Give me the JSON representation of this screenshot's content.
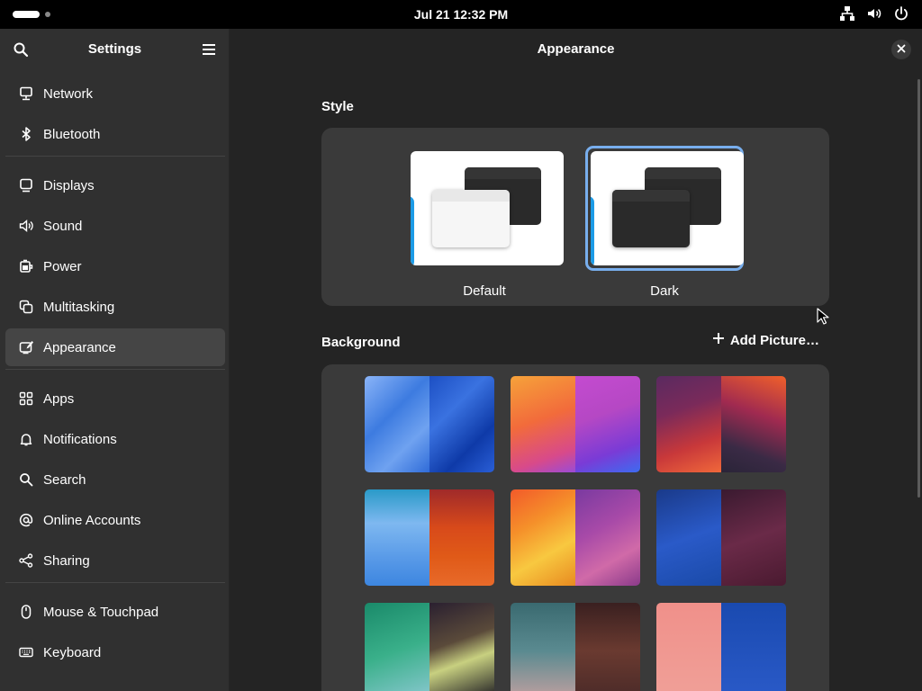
{
  "topbar": {
    "clock": "Jul 21  12:32 PM",
    "tray_icons": [
      "network-wired-icon",
      "volume-icon",
      "power-icon"
    ]
  },
  "sidebar": {
    "title": "Settings",
    "items": [
      {
        "label": "Network",
        "icon": "network-icon"
      },
      {
        "label": "Bluetooth",
        "icon": "bluetooth-icon"
      },
      {
        "label": "Displays",
        "icon": "display-icon"
      },
      {
        "label": "Sound",
        "icon": "speaker-icon"
      },
      {
        "label": "Power",
        "icon": "battery-icon"
      },
      {
        "label": "Multitasking",
        "icon": "multitasking-icon"
      },
      {
        "label": "Appearance",
        "icon": "appearance-icon",
        "active": true
      },
      {
        "label": "Apps",
        "icon": "apps-grid-icon"
      },
      {
        "label": "Notifications",
        "icon": "bell-icon"
      },
      {
        "label": "Search",
        "icon": "search-icon"
      },
      {
        "label": "Online Accounts",
        "icon": "at-icon"
      },
      {
        "label": "Sharing",
        "icon": "share-icon"
      },
      {
        "label": "Mouse & Touchpad",
        "icon": "mouse-icon"
      },
      {
        "label": "Keyboard",
        "icon": "keyboard-icon"
      }
    ]
  },
  "content": {
    "title": "Appearance",
    "style": {
      "label": "Style",
      "options": [
        {
          "label": "Default",
          "selected": false
        },
        {
          "label": "Dark",
          "selected": true
        }
      ]
    },
    "background": {
      "label": "Background",
      "add_picture": "Add Picture…"
    }
  },
  "colors": {
    "accent": "#78aeed",
    "sidebar_bg": "#303030",
    "content_bg": "#242424",
    "card_bg": "#3a3a3a"
  }
}
